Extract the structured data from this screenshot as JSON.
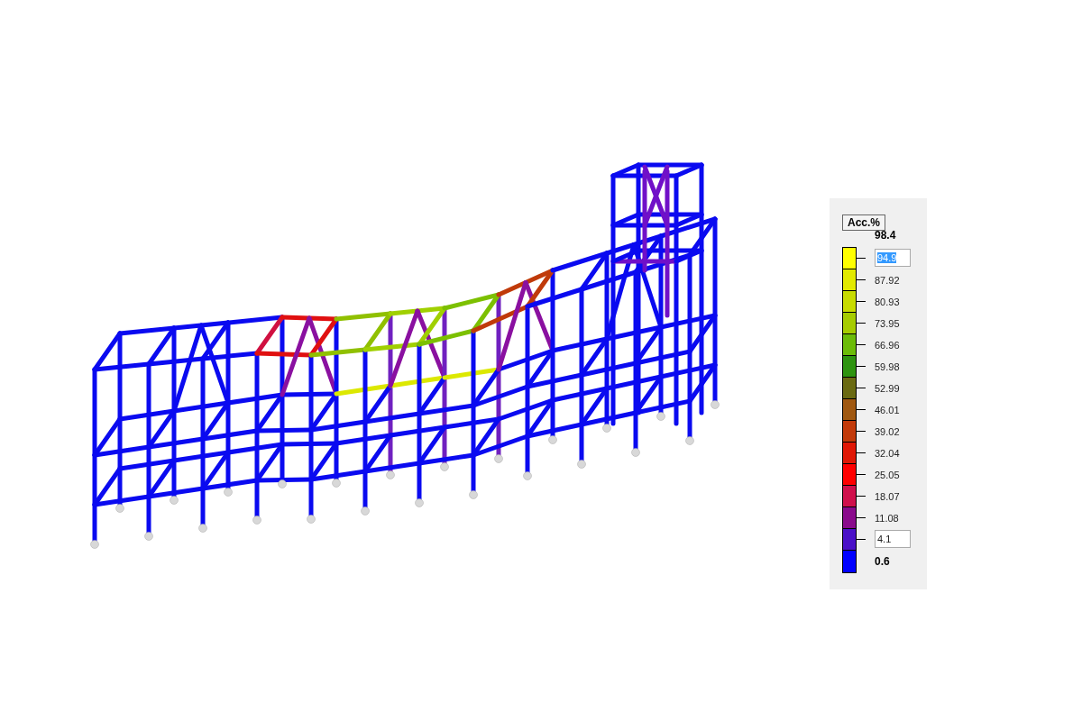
{
  "legend": {
    "button": "Acc.%",
    "max": "98.4",
    "min": "0.6",
    "upper_field": {
      "value": "94.9",
      "text_selected": true
    },
    "lower_field": {
      "value": "4.1",
      "text_selected": false
    },
    "ticks": [
      "87.92",
      "80.93",
      "73.95",
      "66.96",
      "59.98",
      "52.99",
      "46.01",
      "39.02",
      "32.04",
      "25.05",
      "18.07",
      "11.08"
    ],
    "bands": [
      {
        "color": "#ffff00"
      },
      {
        "color": "#e2ea00"
      },
      {
        "color": "#c8dc00"
      },
      {
        "color": "#a6cc00"
      },
      {
        "color": "#6cbc08"
      },
      {
        "color": "#2e9410"
      },
      {
        "color": "#6a6a12"
      },
      {
        "color": "#a05810"
      },
      {
        "color": "#c23a0a"
      },
      {
        "color": "#e01806"
      },
      {
        "color": "#ff0000"
      },
      {
        "color": "#d0104c"
      },
      {
        "color": "#8a0a8c"
      },
      {
        "color": "#4a10c8"
      },
      {
        "color": "#0000ff"
      }
    ]
  }
}
